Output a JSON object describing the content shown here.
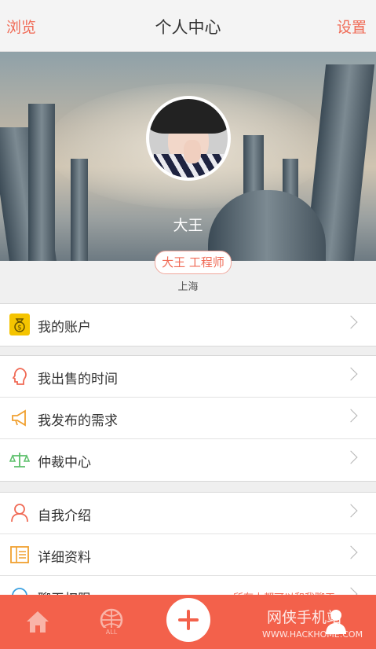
{
  "header": {
    "back_label": "浏览",
    "title": "个人中心",
    "settings_label": "设置"
  },
  "profile": {
    "nickname": "大王",
    "tag": "大王 工程师",
    "location": "上海"
  },
  "groups": [
    {
      "items": [
        {
          "label": "我的账户",
          "icon": "money-bag-icon"
        }
      ]
    },
    {
      "items": [
        {
          "label": "我出售的时间",
          "icon": "head-icon"
        },
        {
          "label": "我发布的需求",
          "icon": "megaphone-icon"
        },
        {
          "label": "仲裁中心",
          "icon": "scale-icon"
        }
      ]
    },
    {
      "items": [
        {
          "label": "自我介绍",
          "icon": "person-icon"
        },
        {
          "label": "详细资料",
          "icon": "list-icon"
        },
        {
          "label": "聊天权限",
          "icon": "chat-icon",
          "value": "所有人都可以和我聊天"
        }
      ]
    }
  ],
  "tabbar": {
    "icons": [
      "home-icon",
      "all-icon",
      "plus-icon",
      "profile-icon"
    ]
  },
  "watermark": {
    "line1": "网侠手机站",
    "line2": "WWW.HACKHOME.COM"
  },
  "colors": {
    "accent": "#f06a55",
    "tabbar": "#f3614b",
    "money": "#f5c400"
  }
}
